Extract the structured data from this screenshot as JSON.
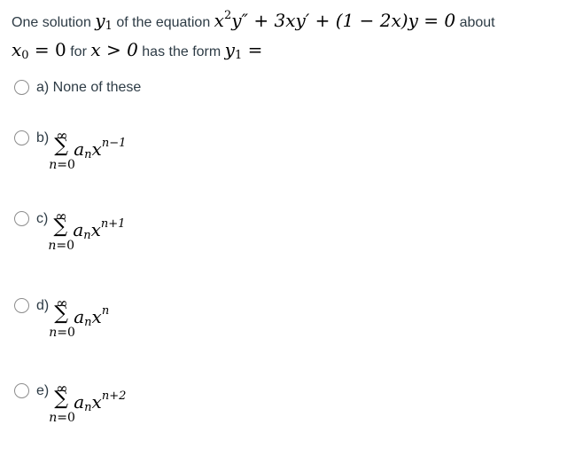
{
  "question": {
    "text_prefix": "One solution",
    "y1_symbol": "y",
    "y1_sub": "1",
    "text_mid": "of the equation",
    "eq_part1": "x",
    "eq_exp": "2",
    "eq_part2": "y″ + 3xy′ + (1 − 2x)y = 0",
    "text_about": "about",
    "x0_symbol": "x",
    "x0_sub": "0",
    "x0_eq": " = 0",
    "text_for": "for",
    "cond": "x > 0",
    "text_form": "has the form",
    "y1_eq": " ="
  },
  "options": [
    {
      "label": "a) None of these",
      "has_sum": false
    },
    {
      "label": "b)",
      "has_sum": true,
      "upper": "∞",
      "sigma": "∑",
      "coef": "a",
      "coef_sub": "n",
      "var": "x",
      "exponent": "n−1",
      "lower_var": "n",
      "lower_eq": "=0"
    },
    {
      "label": "c)",
      "has_sum": true,
      "upper": "∞",
      "sigma": "∑",
      "coef": "a",
      "coef_sub": "n",
      "var": "x",
      "exponent": "n+1",
      "lower_var": "n",
      "lower_eq": "=0"
    },
    {
      "label": "d)",
      "has_sum": true,
      "upper": "∞",
      "sigma": "∑",
      "coef": "a",
      "coef_sub": "n",
      "var": "x",
      "exponent": "n",
      "lower_var": "n",
      "lower_eq": "=0"
    },
    {
      "label": "e)",
      "has_sum": true,
      "upper": "∞",
      "sigma": "∑",
      "coef": "a",
      "coef_sub": "n",
      "var": "x",
      "exponent": "n+2",
      "lower_var": "n",
      "lower_eq": "=0"
    }
  ],
  "colors": {
    "text": "#2d3b45",
    "math": "#000000",
    "radio_border": "#8c8c8c"
  }
}
